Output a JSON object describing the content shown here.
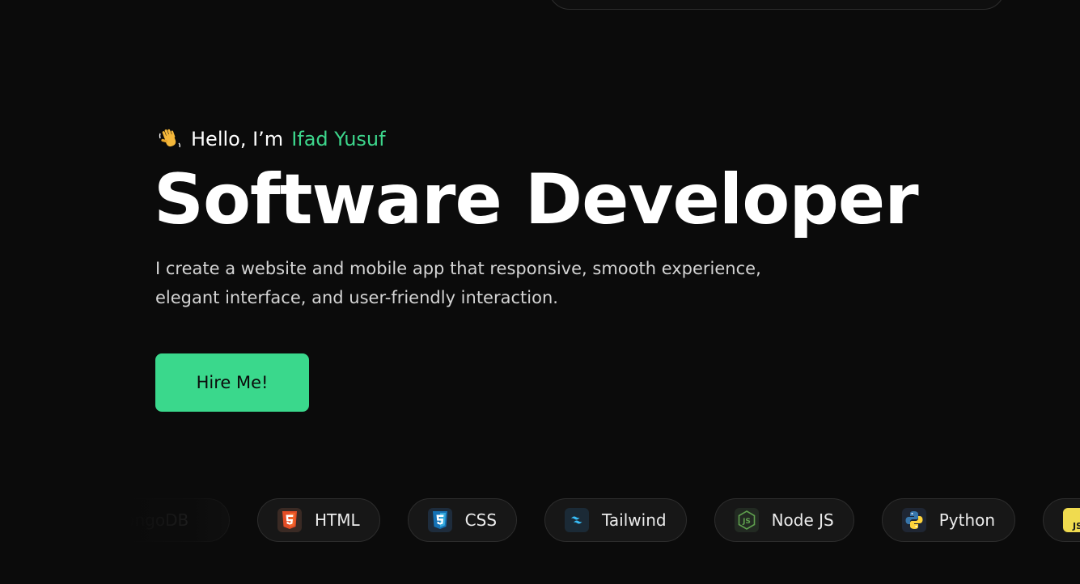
{
  "hero": {
    "greeting_prefix": "Hello, I’m",
    "name": "Ifad Yusuf",
    "title": "Software Developer",
    "description": "I create a website and mobile app that responsive, smooth experience, elegant interface, and user-friendly interaction.",
    "cta_label": "Hire Me!"
  },
  "tech": [
    {
      "label": "MongoDB",
      "icon": "mongodb-icon"
    },
    {
      "label": "HTML",
      "icon": "html5-icon"
    },
    {
      "label": "CSS",
      "icon": "css3-icon"
    },
    {
      "label": "Tailwind",
      "icon": "tailwind-icon"
    },
    {
      "label": "Node JS",
      "icon": "nodejs-icon"
    },
    {
      "label": "Python",
      "icon": "python-icon"
    },
    {
      "label": "JS",
      "icon": "javascript-icon"
    }
  ],
  "colors": {
    "background": "#0b0b0b",
    "accent": "#3ad88c",
    "name_color": "#3dd68c"
  }
}
